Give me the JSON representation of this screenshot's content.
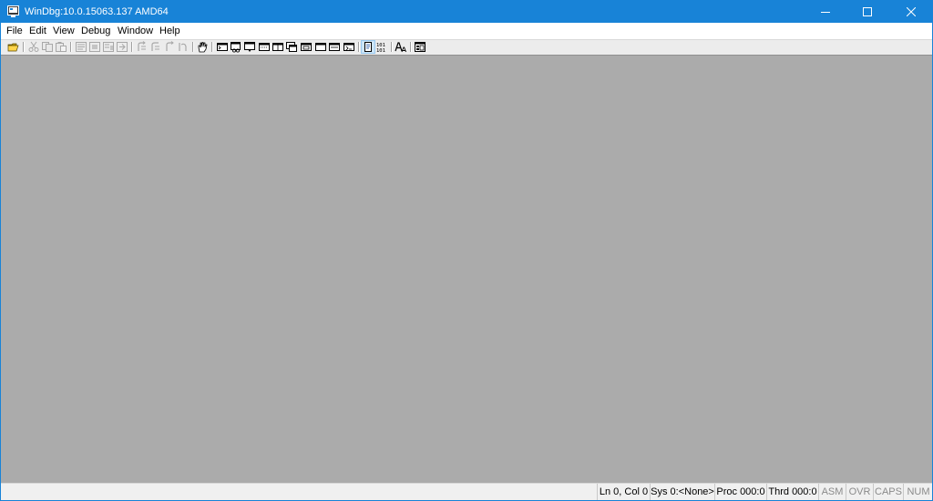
{
  "window": {
    "title": "WinDbg:10.0.15063.137 AMD64"
  },
  "menu": {
    "items": [
      "File",
      "Edit",
      "View",
      "Debug",
      "Window",
      "Help"
    ]
  },
  "toolbar": {
    "buttons": [
      {
        "icon": "open-icon",
        "enabled": true
      },
      {
        "icon": "cut-icon",
        "enabled": false
      },
      {
        "icon": "copy-icon",
        "enabled": false
      },
      {
        "icon": "paste-icon",
        "enabled": false
      },
      {
        "icon": "go-icon",
        "enabled": false
      },
      {
        "icon": "restart-icon",
        "enabled": false
      },
      {
        "icon": "stop-debugging-icon",
        "enabled": false
      },
      {
        "icon": "break-icon",
        "enabled": false
      },
      {
        "icon": "step-into-icon",
        "enabled": false
      },
      {
        "icon": "step-over-icon",
        "enabled": false
      },
      {
        "icon": "step-out-icon",
        "enabled": false
      },
      {
        "icon": "run-to-cursor-icon",
        "enabled": false
      },
      {
        "icon": "hand-icon",
        "enabled": true
      },
      {
        "icon": "command-window-icon",
        "enabled": true
      },
      {
        "icon": "watch-window-icon",
        "enabled": true
      },
      {
        "icon": "locals-window-icon",
        "enabled": true
      },
      {
        "icon": "registers-window-icon",
        "enabled": true
      },
      {
        "icon": "memory-window-icon",
        "enabled": true
      },
      {
        "icon": "call-stack-window-icon",
        "enabled": true
      },
      {
        "icon": "disassembly-window-icon",
        "enabled": true
      },
      {
        "icon": "scratch-pad-window-icon",
        "enabled": true
      },
      {
        "icon": "processes-threads-window-icon",
        "enabled": true
      },
      {
        "icon": "command-browser-window-icon",
        "enabled": true
      },
      {
        "icon": "source-mode-icon",
        "enabled": true,
        "selected": true
      },
      {
        "icon": "binary-mode-icon",
        "enabled": true
      },
      {
        "icon": "font-icon",
        "enabled": true
      },
      {
        "icon": "options-icon",
        "enabled": true
      }
    ]
  },
  "statusbar": {
    "position": "Ln 0, Col 0",
    "system": "Sys 0:<None>",
    "process": "Proc 000:0",
    "thread": "Thrd 000:0",
    "asm": "ASM",
    "ovr": "OVR",
    "caps": "CAPS",
    "num": "NUM"
  },
  "colors": {
    "titlebar": "#1883d7",
    "client": "#ababab",
    "toolbar": "#ececec",
    "statusbar": "#f0f0f0"
  }
}
